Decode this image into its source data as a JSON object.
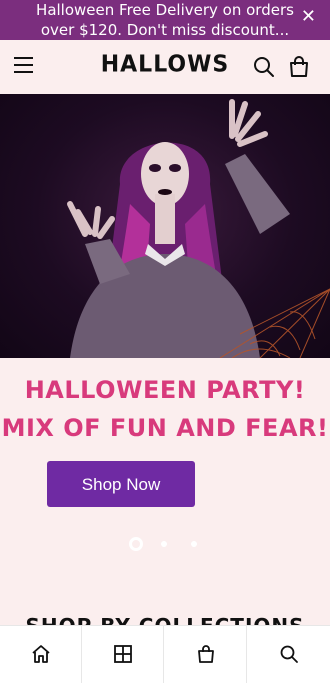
{
  "announcement": {
    "text": "Halloween Free Delivery on orders over $120. Don't miss discount...",
    "close_icon": "close-icon"
  },
  "header": {
    "menu_icon": "hamburger-menu-icon",
    "logo_text": "HALLOWS",
    "search_icon": "search-icon",
    "cart_icon": "shopping-bag-icon"
  },
  "hero": {
    "image": "woman-in-halloween-makeup-with-spiderweb",
    "headline_line1": "HALLOWEEN PARTY!",
    "headline_line2": "MIX OF FUN AND FEAR!",
    "cta_label": "Shop Now",
    "slides_total": 3,
    "active_slide": 1
  },
  "section": {
    "title": "SHOP BY COLLECTIONS"
  },
  "bottom_nav": {
    "items": [
      {
        "icon": "home-icon"
      },
      {
        "icon": "grid-icon"
      },
      {
        "icon": "shopping-bag-icon"
      },
      {
        "icon": "search-icon"
      }
    ]
  },
  "colors": {
    "announcement_bg": "#7b2e7e",
    "page_bg": "#fbeeee",
    "headline": "#d83a7c",
    "button_bg": "#6f2aa3"
  }
}
